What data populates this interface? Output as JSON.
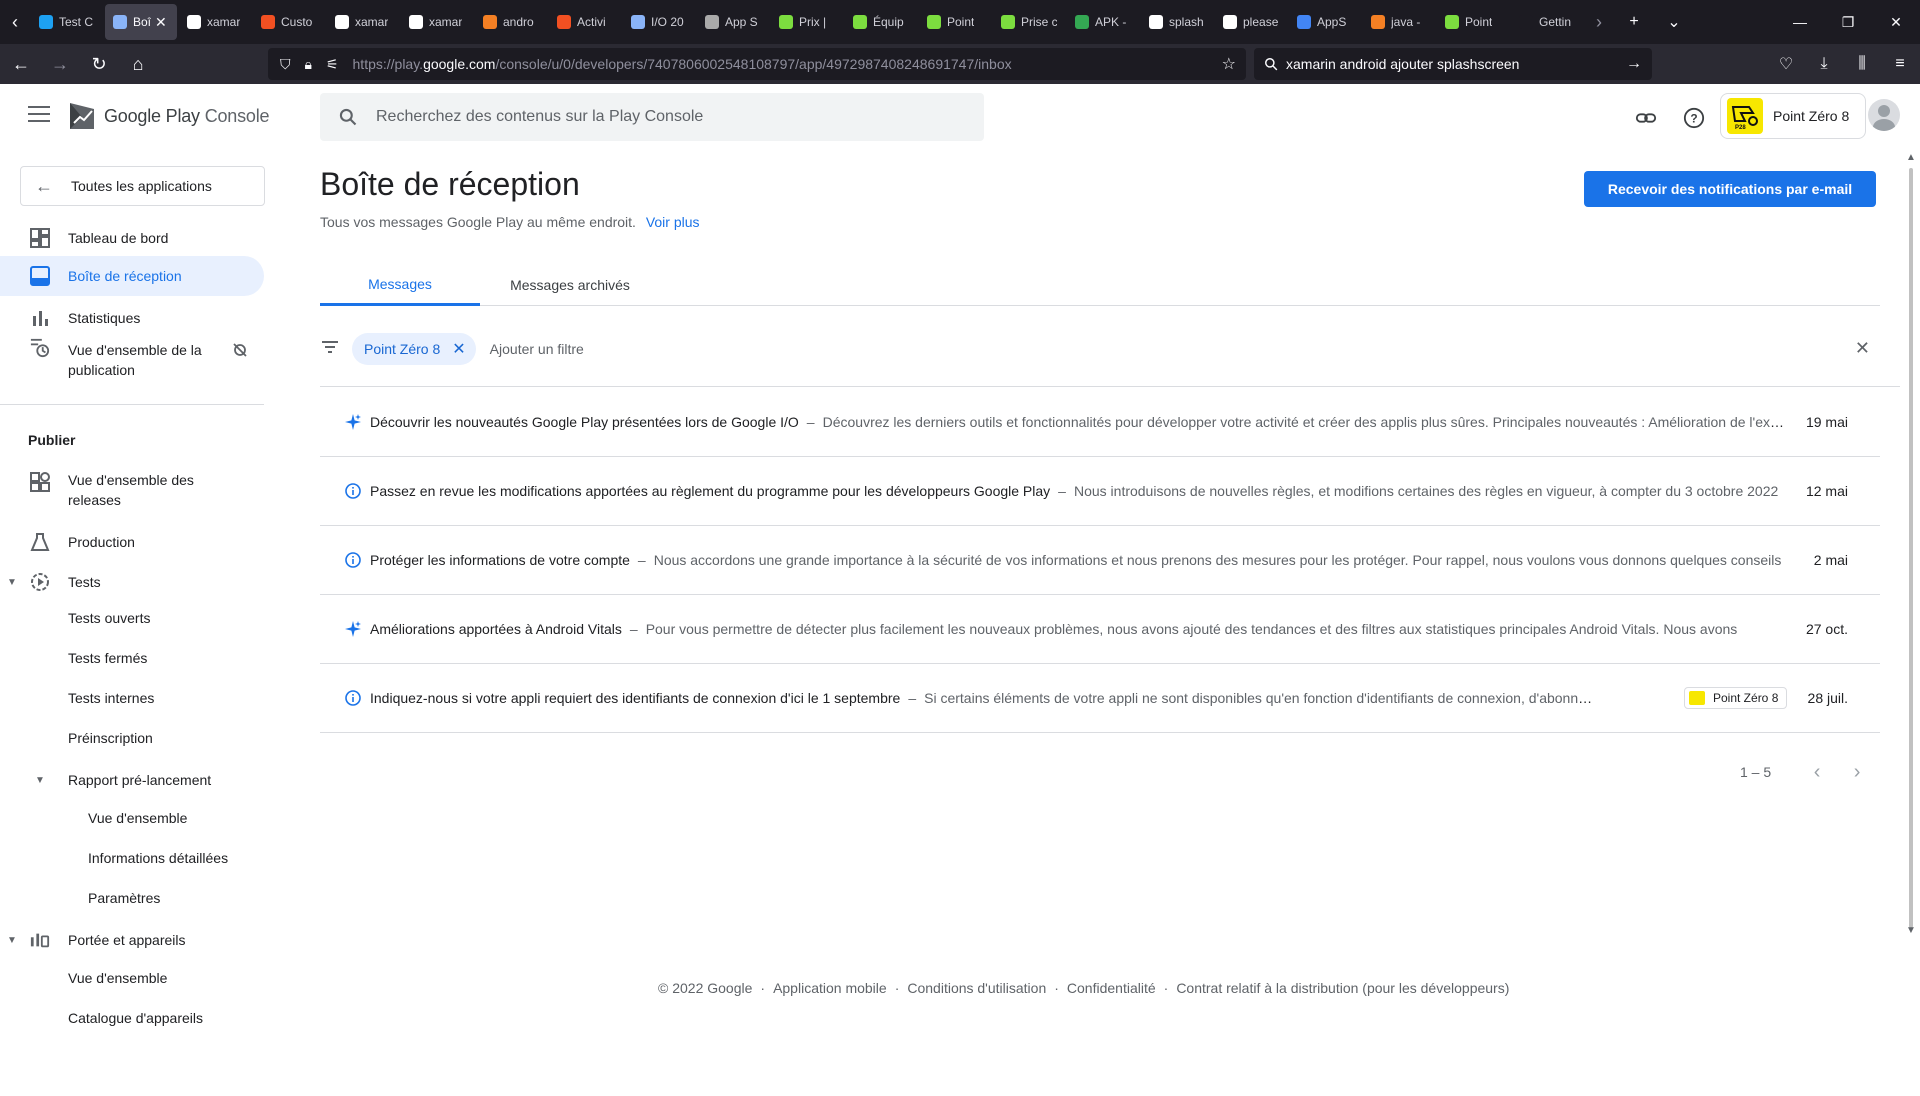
{
  "browser": {
    "tabs": [
      {
        "label": "Test C",
        "color": "#1da1f2"
      },
      {
        "label": "Boî",
        "color": "#8ab4f8",
        "active": true
      },
      {
        "label": "xamar",
        "color": "#ffffff"
      },
      {
        "label": "Custo",
        "color": "#f25022"
      },
      {
        "label": "xamar",
        "color": "#ffffff"
      },
      {
        "label": "xamar",
        "color": "#ffffff"
      },
      {
        "label": "andro",
        "color": "#f48024"
      },
      {
        "label": "Activi",
        "color": "#f25022"
      },
      {
        "label": "I/O 20",
        "color": "#8ab4f8"
      },
      {
        "label": "App S",
        "color": "#aaaaaa"
      },
      {
        "label": "Prix |",
        "color": "#7cdd3f"
      },
      {
        "label": "Équip",
        "color": "#7cdd3f"
      },
      {
        "label": "Point",
        "color": "#7cdd3f"
      },
      {
        "label": "Prise c",
        "color": "#7cdd3f"
      },
      {
        "label": "APK -",
        "color": "#34a853"
      },
      {
        "label": "splash",
        "color": "#ffffff"
      },
      {
        "label": "please",
        "color": "#ffffff"
      },
      {
        "label": "AppS",
        "color": "#4285f4"
      },
      {
        "label": "java -",
        "color": "#f48024"
      },
      {
        "label": "Point",
        "color": "#7cdd3f"
      },
      {
        "label": "Gettin",
        "color": "#1c1b22"
      }
    ],
    "url_prefix": "https://play.",
    "url_domain": "google.com",
    "url_rest": "/console/u/0/developers/7407806002548108797/app/4972987408248691747/inbox",
    "search_value": "xamarin android ajouter splashscreen"
  },
  "console": {
    "logo_google": "Google Play",
    "logo_console": "Console",
    "search_placeholder": "Recherchez des contenus sur la Play Console",
    "account_name": "Point Zéro 8",
    "account_logo_text": "P28"
  },
  "sidebar": {
    "all_apps": "Toutes les applications",
    "items": [
      {
        "label": "Tableau de bord",
        "icon": "dashboard-icon"
      },
      {
        "label": "Boîte de réception",
        "icon": "inbox-icon"
      },
      {
        "label": "Statistiques",
        "icon": "bar-chart-icon"
      },
      {
        "label": "Vue d'ensemble de la publication",
        "icon": "history-icon"
      }
    ],
    "section_publish": "Publier",
    "publish_items": [
      {
        "label": "Vue d'ensemble des releases"
      },
      {
        "label": "Production"
      },
      {
        "label": "Tests"
      },
      {
        "label": "Tests ouverts"
      },
      {
        "label": "Tests fermés"
      },
      {
        "label": "Tests internes"
      },
      {
        "label": "Préinscription"
      },
      {
        "label": "Rapport pré-lancement"
      },
      {
        "label": "Vue d'ensemble"
      },
      {
        "label": "Informations détaillées"
      },
      {
        "label": "Paramètres"
      },
      {
        "label": "Portée et appareils"
      },
      {
        "label": "Vue d'ensemble"
      },
      {
        "label": "Catalogue d'appareils"
      }
    ]
  },
  "main": {
    "title": "Boîte de réception",
    "subtitle": "Tous vos messages Google Play au même endroit.",
    "see_more": "Voir plus",
    "email_button": "Recevoir des notifications par e-mail",
    "tabs": [
      "Messages",
      "Messages archivés"
    ],
    "filter_chip": "Point Zéro 8",
    "add_filter": "Ajouter un filtre",
    "messages": [
      {
        "icon": "sparkle-icon",
        "title": "Découvrir les nouveautés Google Play présentées lors de Google I/O",
        "desc": "Découvrez les derniers outils et fonctionnalités pour développer votre activité et créer des applis plus sûres. Principales nouveautés : Amélioration de l'expérience",
        "date": "19 mai"
      },
      {
        "icon": "info-icon",
        "title": "Passez en revue les modifications apportées au règlement du programme pour les développeurs Google Play",
        "desc": "Nous introduisons de nouvelles règles, et modifions certaines des règles en vigueur, à compter du 3 octobre 2022",
        "date": "12 mai"
      },
      {
        "icon": "info-icon",
        "title": "Protéger les informations de votre compte",
        "desc": "Nous accordons une grande importance à la sécurité de vos informations et nous prenons des mesures pour les protéger. Pour rappel, nous voulons vous donnons quelques conseils",
        "date": "2 mai"
      },
      {
        "icon": "sparkle-icon",
        "title": "Améliorations apportées à Android Vitals",
        "desc": "Pour vous permettre de détecter plus facilement les nouveaux problèmes, nous avons ajouté des tendances et des filtres aux statistiques principales Android Vitals. Nous avons",
        "date": "27 oct."
      },
      {
        "icon": "info-icon",
        "title": "Indiquez-nous si votre appli requiert des identifiants de connexion d'ici le 1 septembre",
        "desc": "Si certains éléments de votre appli ne sont disponibles qu'en fonction d'identifiants de connexion, d'abonnements",
        "date": "28 juil.",
        "tag": "Point Zéro 8"
      }
    ],
    "pagination": "1 – 5"
  },
  "footer": {
    "copyright": "© 2022 Google",
    "links": [
      "Application mobile",
      "Conditions d'utilisation",
      "Confidentialité",
      "Contrat relatif à la distribution (pour les développeurs)"
    ]
  },
  "colors": {
    "accent": "#1a73e8",
    "active_bg": "#e8f0fe",
    "brand_yellow": "#f7e700"
  }
}
